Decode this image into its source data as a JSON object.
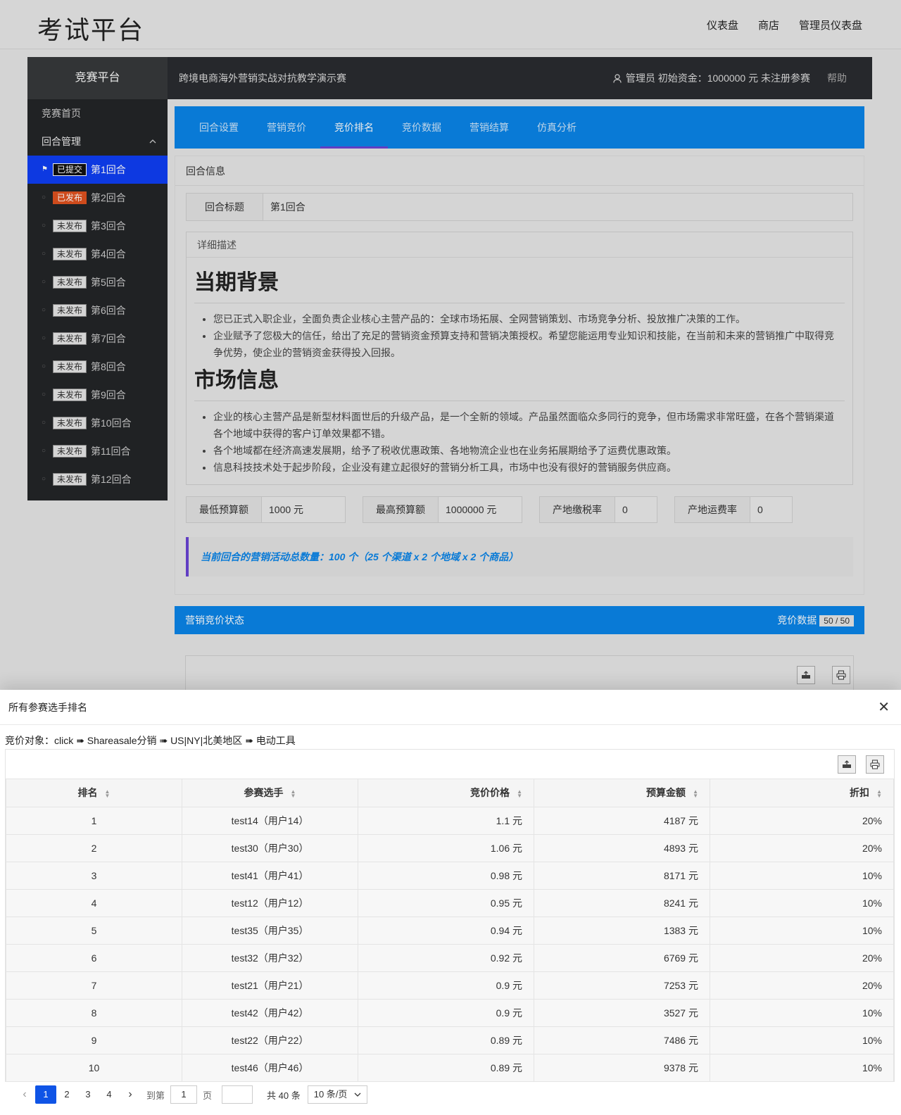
{
  "topnav": {
    "brand": "考试平台",
    "links": [
      "仪表盘",
      "商店",
      "管理员仪表盘"
    ]
  },
  "header": {
    "platform": "竞赛平台",
    "contest_title": "跨境电商海外营销实战对抗教学演示赛",
    "user_info": "管理员 初始资金：1000000 元 未注册参赛",
    "help": "帮助"
  },
  "sidebar": {
    "home": "竞赛首页",
    "management": "回合管理",
    "rounds": [
      {
        "status": "已提交",
        "label": "第1回合"
      },
      {
        "status": "已发布",
        "label": "第2回合"
      },
      {
        "status": "未发布",
        "label": "第3回合"
      },
      {
        "status": "未发布",
        "label": "第4回合"
      },
      {
        "status": "未发布",
        "label": "第5回合"
      },
      {
        "status": "未发布",
        "label": "第6回合"
      },
      {
        "status": "未发布",
        "label": "第7回合"
      },
      {
        "status": "未发布",
        "label": "第8回合"
      },
      {
        "status": "未发布",
        "label": "第9回合"
      },
      {
        "status": "未发布",
        "label": "第10回合"
      },
      {
        "status": "未发布",
        "label": "第11回合"
      },
      {
        "status": "未发布",
        "label": "第12回合"
      }
    ]
  },
  "tabs": [
    "回合设置",
    "营销竞价",
    "竞价排名",
    "竞价数据",
    "营销结算",
    "仿真分析"
  ],
  "round_info": {
    "card_title": "回合信息",
    "title_label": "回合标题",
    "title_value": "第1回合",
    "desc_label": "详细描述",
    "sections": [
      {
        "heading": "当期背景",
        "items": [
          "您已正式入职企业，全面负责企业核心主营产品的：全球市场拓展、全网营销策划、市场竞争分析、投放推广决策的工作。",
          "企业赋予了您极大的信任，给出了充足的营销资金预算支持和营销决策授权。希望您能运用专业知识和技能，在当前和未来的营销推广中取得竞争优势，使企业的营销资金获得投入回报。"
        ]
      },
      {
        "heading": "市场信息",
        "items": [
          "企业的核心主营产品是新型材料面世后的升级产品，是一个全新的领域。产品虽然面临众多同行的竞争，但市场需求非常旺盛，在各个营销渠道各个地域中获得的客户订单效果都不错。",
          "各个地域都在经济高速发展期，给予了税收优惠政策、各地物流企业也在业务拓展期给予了运费优惠政策。",
          "信息科技技术处于起步阶段，企业没有建立起很好的营销分析工具，市场中也没有很好的营销服务供应商。"
        ]
      }
    ],
    "params": [
      {
        "label": "最低预算额",
        "value": "1000 元"
      },
      {
        "label": "最高预算额",
        "value": "1000000 元"
      },
      {
        "label": "产地缴税率",
        "value": "0"
      },
      {
        "label": "产地运费率",
        "value": "0"
      }
    ],
    "note": "当前回合的营销活动总数量：100 个（25 个渠道 x 2 个地域 x 2 个商品）"
  },
  "status_card": {
    "title": "营销竞价状态",
    "data_label": "竞价数据",
    "count": "50 / 50"
  },
  "modal": {
    "title": "所有参赛选手排名",
    "target": "竞价对象：click ➠ Shareasale分销 ➠ US|NY|北美地区 ➠ 电动工具",
    "columns": [
      "排名",
      "参赛选手",
      "竞价价格",
      "预算金额",
      "折扣"
    ],
    "rows": [
      [
        "1",
        "test14（用户14）",
        "1.1 元",
        "4187 元",
        "20%"
      ],
      [
        "2",
        "test30（用户30）",
        "1.06 元",
        "4893 元",
        "20%"
      ],
      [
        "3",
        "test41（用户41）",
        "0.98 元",
        "8171 元",
        "10%"
      ],
      [
        "4",
        "test12（用户12）",
        "0.95 元",
        "8241 元",
        "10%"
      ],
      [
        "5",
        "test35（用户35）",
        "0.94 元",
        "1383 元",
        "10%"
      ],
      [
        "6",
        "test32（用户32）",
        "0.92 元",
        "6769 元",
        "20%"
      ],
      [
        "7",
        "test21（用户21）",
        "0.9 元",
        "7253 元",
        "20%"
      ],
      [
        "8",
        "test42（用户42）",
        "0.9 元",
        "3527 元",
        "10%"
      ],
      [
        "9",
        "test22（用户22）",
        "0.89 元",
        "7486 元",
        "10%"
      ],
      [
        "10",
        "test46（用户46）",
        "0.89 元",
        "9378 元",
        "10%"
      ]
    ],
    "pager": {
      "pages": [
        "1",
        "2",
        "3",
        "4"
      ],
      "goto": "到第",
      "goto_value": "1",
      "page_unit": "页",
      "total": "共 40 条",
      "page_size": "10 条/页"
    }
  }
}
